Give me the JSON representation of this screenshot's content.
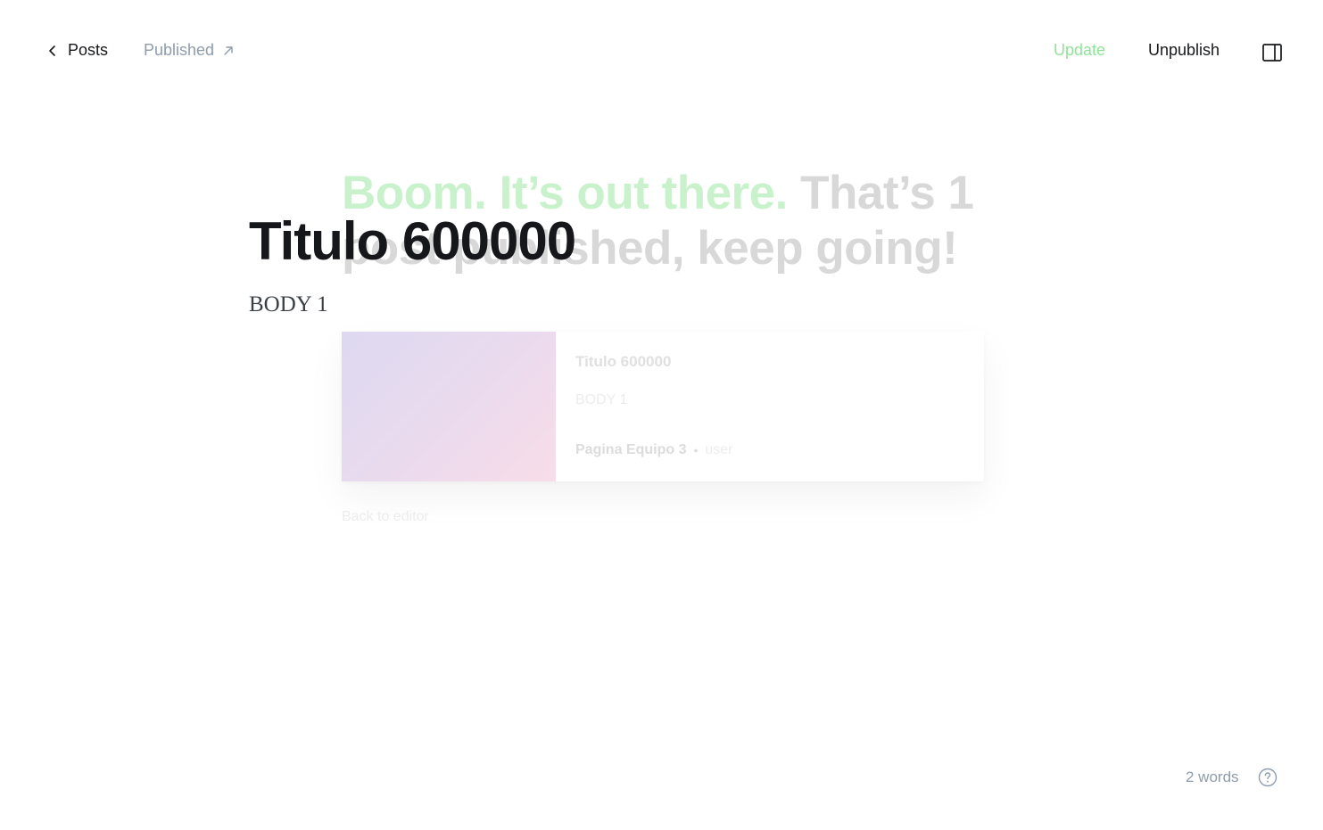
{
  "topbar": {
    "back_label": "Posts",
    "status_label": "Published",
    "update_label": "Update",
    "unpublish_label": "Unpublish"
  },
  "editor": {
    "title": "Titulo 600000",
    "body": "BODY 1"
  },
  "celebration": {
    "headline_accent": "Boom. It’s out there.",
    "headline_rest": "That’s 1 post published, keep going!",
    "card": {
      "title": "Titulo 600000",
      "excerpt": "BODY 1",
      "site": "Pagina Equipo 3",
      "separator": "•",
      "author": "user"
    },
    "back_to_editor": "Back to editor"
  },
  "footer": {
    "word_count": "2 words"
  },
  "icons": {
    "back": "chevron-left-icon",
    "external": "arrow-up-right-icon",
    "sidebar": "sidebar-panel-icon",
    "help": "question-circle-icon"
  },
  "colors": {
    "accent_green": "#30cf43",
    "text": "#15171a",
    "muted": "#8e9cac"
  }
}
